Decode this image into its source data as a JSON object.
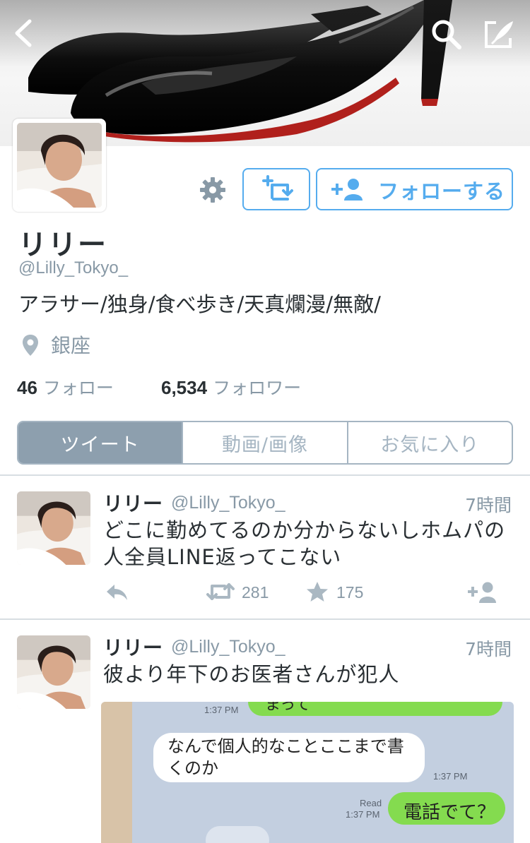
{
  "header": {
    "back_icon": "chevron-left-icon",
    "search_icon": "search-icon",
    "compose_icon": "compose-tweet-icon"
  },
  "profile": {
    "display_name": "リリー",
    "handle": "@Lilly_Tokyo_",
    "bio": "アラサー/独身/食べ歩き/天真爛漫/無敵/",
    "location": "銀座",
    "following_count": "46",
    "following_label": "フォロー",
    "followers_count": "6,534",
    "followers_label": "フォロワー",
    "follow_button_label": "フォローする",
    "settings_icon": "gear-icon",
    "retweet_toggle_icon": "retweet-add-icon"
  },
  "tabs": [
    {
      "label": "ツイート",
      "active": true
    },
    {
      "label": "動画/画像",
      "active": false
    },
    {
      "label": "お気に入り",
      "active": false
    }
  ],
  "tweets": [
    {
      "name": "リリー",
      "handle": "@Lilly_Tokyo_",
      "time": "7時間",
      "text_lines": [
        "どこに勤めてるのか分からないしホムパの",
        "人全員LINE返ってこない"
      ],
      "retweets": "281",
      "favorites": "175"
    },
    {
      "name": "リリー",
      "handle": "@Lilly_Tokyo_",
      "time": "7時間",
      "text_lines": [
        "彼より年下のお医者さんが犯人"
      ],
      "media": {
        "partial_green_text": "まって",
        "time_top": "1:37 PM",
        "white_bubble_lines": [
          "なんで個人的なことここまで書",
          "くのか"
        ],
        "time_white": "1:37 PM",
        "read_label": "Read",
        "time_green": "1:37 PM",
        "green_bubble": "電話でて？"
      }
    }
  ],
  "colors": {
    "accent": "#55acee",
    "muted": "#8899a6",
    "tab_active": "#8d9fae",
    "line_green": "#84db4f",
    "line_background": "#c3cfe0"
  }
}
